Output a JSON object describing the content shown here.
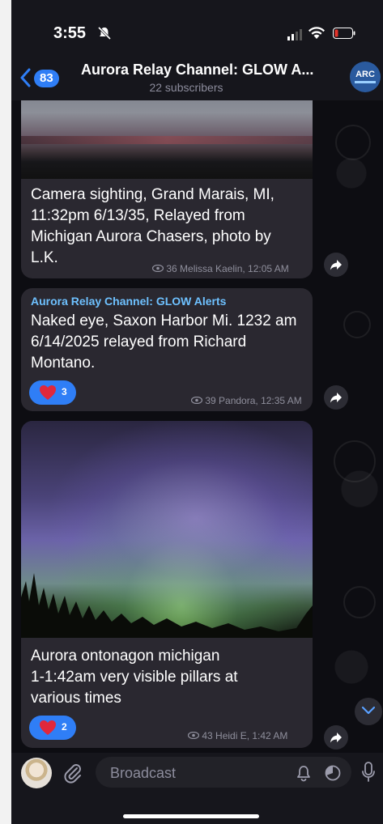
{
  "status": {
    "time": "3:55"
  },
  "header": {
    "back_count": "83",
    "title": "Aurora Relay Channel: GLOW A...",
    "subscribers": "22 subscribers",
    "avatar_text": "ARC"
  },
  "messages": [
    {
      "text_lines": [
        "Camera sighting, Grand Marais, MI,",
        "11:32pm 6/13/35, Relayed from",
        "Michigan Aurora Chasers, photo by",
        "L.K."
      ],
      "meta": "36 Melissa Kaelin, 12:05 AM"
    },
    {
      "sender": "Aurora Relay Channel: GLOW Alerts",
      "text_lines": [
        "Naked eye,  Saxon Harbor Mi. 1232 am",
        "6/14/2025 relayed from Richard",
        "Montano."
      ],
      "reaction_count": "3",
      "meta": "39 Pandora, 12:35 AM"
    },
    {
      "text_lines": [
        "Aurora ontonagon michigan",
        "1-1:42am very visible pillars at",
        "various times"
      ],
      "reaction_count": "2",
      "meta": "43 Heidi E, 1:42 AM"
    }
  ],
  "input": {
    "placeholder": "Broadcast"
  },
  "colors": {
    "accent": "#2f7ef6",
    "sender": "#6ec1ff",
    "reaction": "#2f7ef6",
    "heart": "#e0283c"
  }
}
